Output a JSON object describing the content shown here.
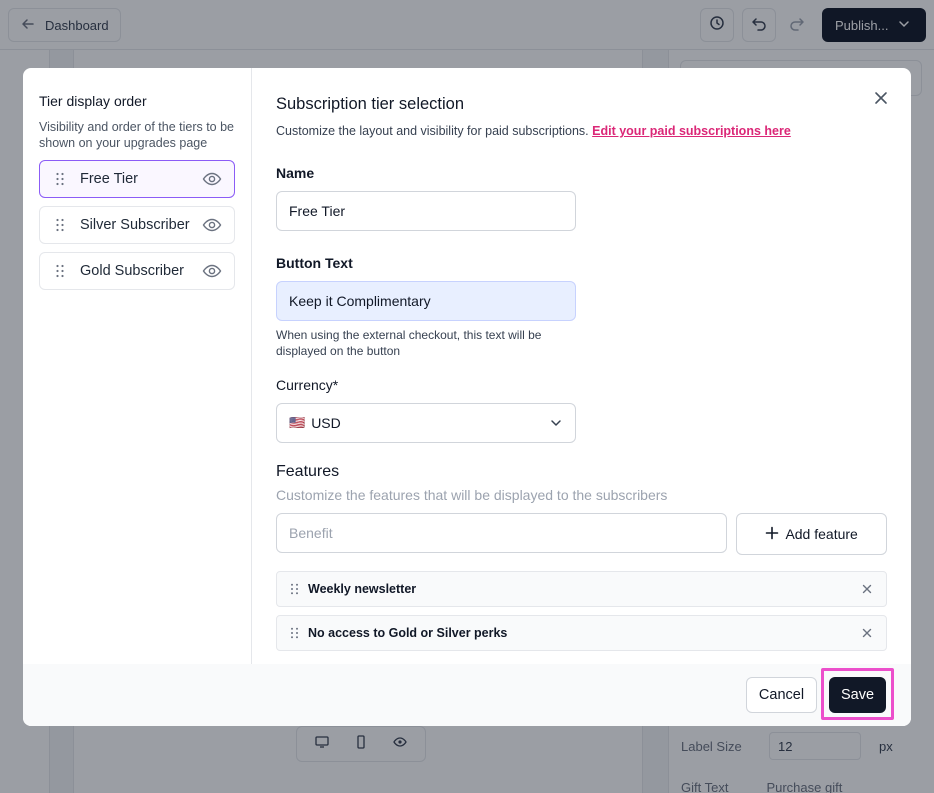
{
  "app": {
    "back_label": "Dashboard",
    "publish_label": "Publish...",
    "right_panel": {
      "label_size_label": "Label Size",
      "label_size_value": "12",
      "label_size_unit": "px",
      "gift_text_label": "Gift Text",
      "gift_text_value": "Purchase gift"
    }
  },
  "modal": {
    "sidebar": {
      "title": "Tier display order",
      "description": "Visibility and order of the tiers to be shown on your upgrades page",
      "tiers": [
        {
          "label": "Free Tier",
          "active": true
        },
        {
          "label": "Silver Subscriber",
          "active": false
        },
        {
          "label": "Gold Subscriber",
          "active": false
        }
      ]
    },
    "title": "Subscription tier selection",
    "description": "Customize the layout and visibility for paid subscriptions.",
    "edit_link": "Edit your paid subscriptions here",
    "name": {
      "label": "Name",
      "value": "Free Tier"
    },
    "button_text": {
      "label": "Button Text",
      "value": "Keep it Complimentary",
      "help": "When using the external checkout, this text will be displayed on the button"
    },
    "currency": {
      "label": "Currency*",
      "flag": "🇺🇸",
      "value": "USD"
    },
    "features": {
      "title": "Features",
      "description": "Customize the features that will be displayed to the subscribers",
      "placeholder": "Benefit",
      "add_label": "Add feature",
      "items": [
        "Weekly newsletter",
        "No access to Gold or Silver perks"
      ]
    },
    "footer": {
      "cancel_label": "Cancel",
      "save_label": "Save"
    }
  },
  "colors": {
    "accent_link": "#db2777",
    "highlight": "#ec4fcb",
    "active_border": "#8b5cf6",
    "primary_button": "#111827"
  }
}
